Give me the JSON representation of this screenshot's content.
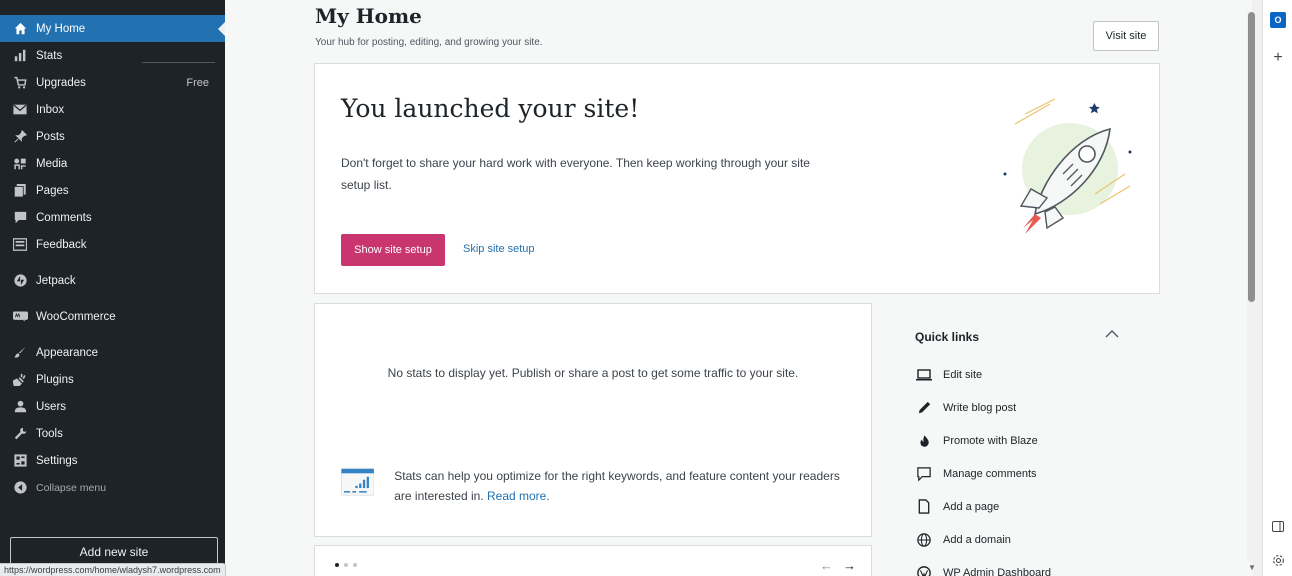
{
  "sidebar": {
    "items": [
      {
        "label": "My Home",
        "icon": "home-icon",
        "active": true
      },
      {
        "label": "Stats",
        "icon": "bar-chart-icon"
      },
      {
        "label": "Upgrades",
        "icon": "cart-icon",
        "badge": "Free"
      },
      {
        "label": "Inbox",
        "icon": "mail-icon"
      },
      {
        "label": "Posts",
        "icon": "pin-icon"
      },
      {
        "label": "Media",
        "icon": "media-icon"
      },
      {
        "label": "Pages",
        "icon": "pages-icon"
      },
      {
        "label": "Comments",
        "icon": "comment-icon"
      },
      {
        "label": "Feedback",
        "icon": "feedback-icon"
      },
      {
        "label": "Jetpack",
        "icon": "jetpack-icon"
      },
      {
        "label": "WooCommerce",
        "icon": "woo-icon"
      },
      {
        "label": "Appearance",
        "icon": "brush-icon"
      },
      {
        "label": "Plugins",
        "icon": "plug-icon"
      },
      {
        "label": "Users",
        "icon": "user-icon"
      },
      {
        "label": "Tools",
        "icon": "wrench-icon"
      },
      {
        "label": "Settings",
        "icon": "settings-icon"
      },
      {
        "label": "Collapse menu",
        "icon": "collapse-icon"
      }
    ],
    "add_site": "Add new site"
  },
  "status_url": "https://wordpress.com/home/wladysh7.wordpress.com",
  "header": {
    "title": "My Home",
    "subtitle": "Your hub for posting, editing, and growing your site.",
    "visit_site": "Visit site"
  },
  "launch": {
    "title": "You launched your site!",
    "body": "Don't forget to share your hard work with everyone. Then keep working through your site setup list.",
    "primary": "Show site setup",
    "secondary": "Skip site setup"
  },
  "stats": {
    "empty": "No stats to display yet. Publish or share a post to get some traffic to your site.",
    "tip": "Stats can help you optimize for the right keywords, and feature content your readers are interested in.",
    "tip_link": "Read more."
  },
  "quick_links": {
    "title": "Quick links",
    "items": [
      {
        "label": "Edit site",
        "icon": "laptop-icon"
      },
      {
        "label": "Write blog post",
        "icon": "pencil-icon"
      },
      {
        "label": "Promote with Blaze",
        "icon": "fire-icon"
      },
      {
        "label": "Manage comments",
        "icon": "comment-outline-icon"
      },
      {
        "label": "Add a page",
        "icon": "page-icon"
      },
      {
        "label": "Add a domain",
        "icon": "globe-icon"
      },
      {
        "label": "WP Admin Dashboard",
        "icon": "wordpress-icon"
      }
    ]
  },
  "colors": {
    "sidebar_bg": "#1d2327",
    "active_blue": "#2271b1",
    "primary_pink": "#c9356e"
  }
}
